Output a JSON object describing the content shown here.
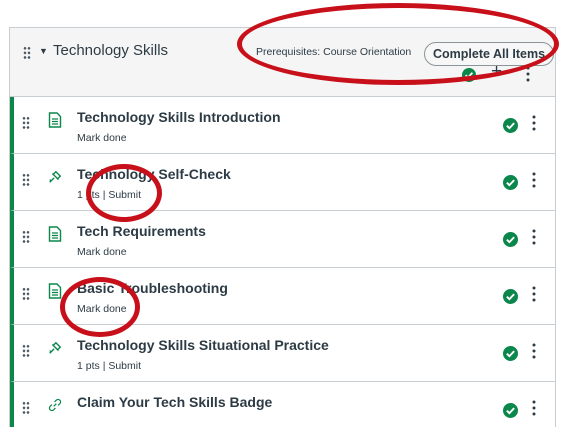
{
  "module": {
    "title": "Technology Skills",
    "prerequisites": "Prerequisites: Course Orientation",
    "complete_all_label": "Complete All Items",
    "add_symbol": "+"
  },
  "items": [
    {
      "title": "Technology Skills Introduction",
      "icon": "page-icon",
      "status": "Mark done"
    },
    {
      "title": "Technology Self-Check",
      "icon": "quiz-icon",
      "points": "1 pts",
      "separator": "|",
      "action": "Submit"
    },
    {
      "title": "Tech Requirements",
      "icon": "page-icon",
      "status": "Mark done"
    },
    {
      "title": "Basic Troubleshooting",
      "icon": "page-icon",
      "status": "Mark done"
    },
    {
      "title": "Technology Skills Situational Practice",
      "icon": "quiz-icon",
      "points": "1 pts",
      "separator": "|",
      "action": "Submit"
    },
    {
      "title": "Claim Your Tech Skills Badge",
      "icon": "link-icon"
    }
  ],
  "colors": {
    "complete_green": "#0b874b",
    "annotation_red": "#c8101a",
    "text": "#2d3b45",
    "border": "#c7cdd1"
  }
}
